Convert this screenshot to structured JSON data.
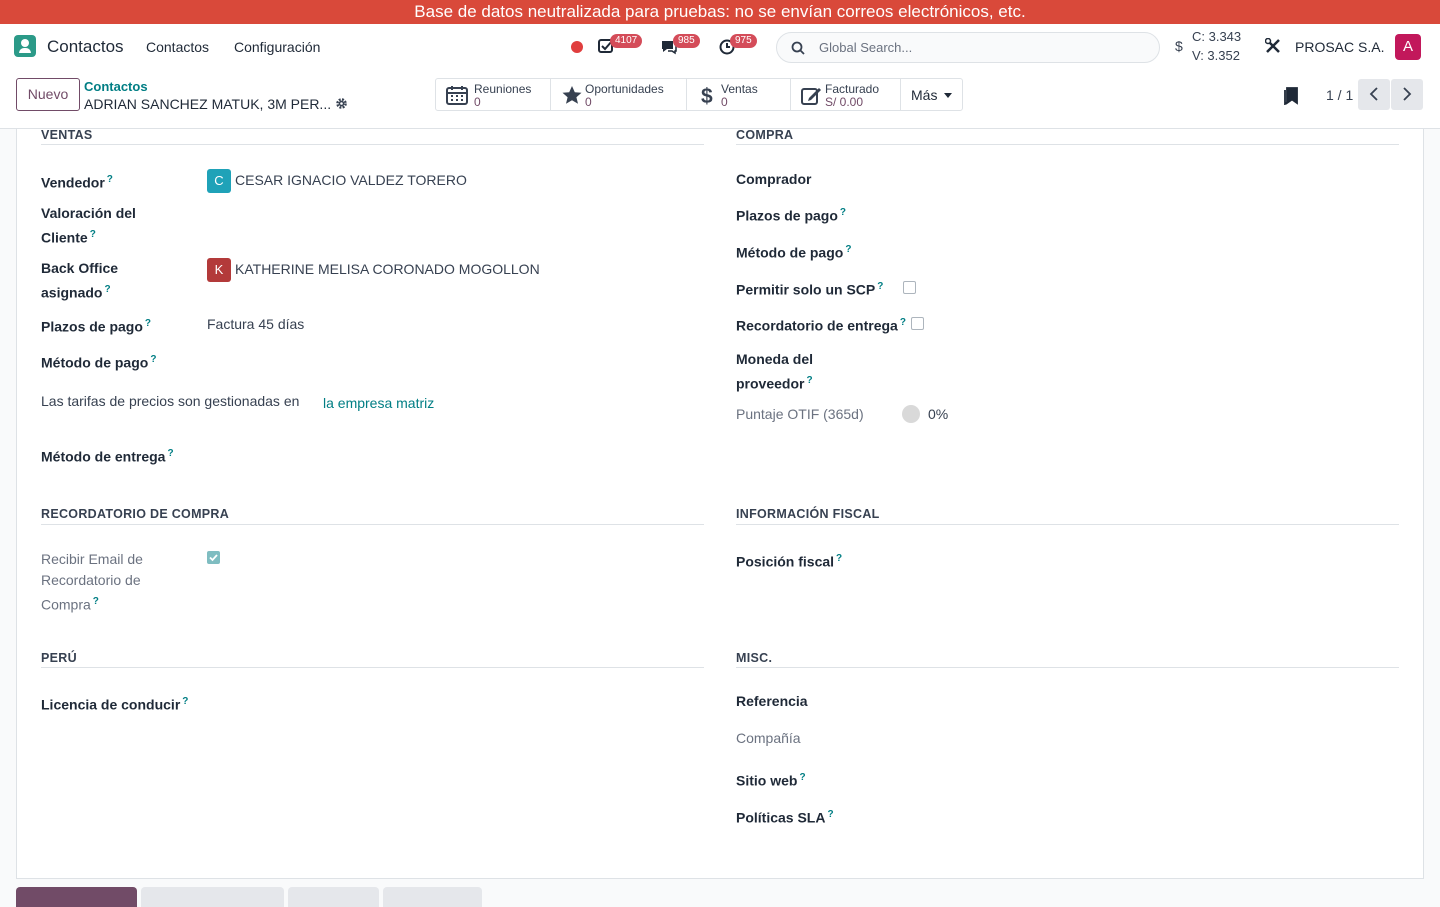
{
  "banner": {
    "text": "Base de datos neutralizada para pruebas: no se envían correos electrónicos, etc."
  },
  "navbar": {
    "app_name": "Contactos",
    "menu": [
      "Contactos",
      "Configuración"
    ],
    "activities_count": "4107",
    "messages_count": "985",
    "timer_count": "975",
    "search_placeholder": "Global Search...",
    "currency_symbol": "$",
    "rate_buy": "C: 3.343",
    "rate_sell": "V: 3.352",
    "company": "PROSAC S.A.",
    "avatar_letter": "A",
    "colors": {
      "brand": "#714b67",
      "banner": "#d9493a",
      "badge": "#d44c59",
      "link": "#017e84"
    }
  },
  "control": {
    "new_button": "Nuevo",
    "breadcrumb": "Contactos",
    "record_name": "ADRIAN SANCHEZ MATUK, 3M PER...",
    "stats": [
      {
        "label": "Reuniones",
        "value": "0",
        "icon": "calendar-icon"
      },
      {
        "label": "Oportunidades",
        "value": "0",
        "icon": "star-icon"
      },
      {
        "label": "Ventas",
        "value": "0",
        "icon": "dollar-icon"
      },
      {
        "label": "Facturado",
        "value": "S/ 0.00",
        "icon": "invoice-edit-icon"
      }
    ],
    "more": "Más",
    "pager": "1 / 1"
  },
  "ventas": {
    "title": "VENTAS",
    "vendedor_label": "Vendedor",
    "vendedor_initial": "C",
    "vendedor_value": "CESAR IGNACIO VALDEZ TORERO",
    "valoracion_label_1": "Valoración del",
    "valoracion_label_2": "Cliente",
    "backoffice_label_1": "Back Office",
    "backoffice_label_2": "asignado",
    "backoffice_initial": "K",
    "backoffice_value": "KATHERINE MELISA CORONADO MOGOLLON",
    "plazos_label": "Plazos de pago",
    "plazos_value": "Factura 45 días",
    "metodo_label": "Método de pago",
    "tarifas_text": "Las tarifas de precios son gestionadas en",
    "tarifas_link": "la empresa matriz",
    "entrega_label": "Método de entrega"
  },
  "compra": {
    "title": "COMPRA",
    "comprador_label": "Comprador",
    "plazos_label": "Plazos de pago",
    "metodo_label": "Método de pago",
    "scp_label": "Permitir solo un SCP",
    "scp_checked": false,
    "recordatorio_label": "Recordatorio de entrega",
    "recordatorio_checked": false,
    "moneda_label_1": "Moneda del",
    "moneda_label_2": "proveedor",
    "otif_label": "Puntaje OTIF (365d)",
    "otif_value": "0%"
  },
  "recordatorio_compra": {
    "title": "RECORDATORIO DE COMPRA",
    "email_label_1": "Recibir Email de",
    "email_label_2": "Recordatorio de",
    "email_label_3": "Compra",
    "email_checked": true
  },
  "fiscal": {
    "title": "INFORMACIÓN FISCAL",
    "posicion_label": "Posición fiscal"
  },
  "peru": {
    "title": "PERÚ",
    "licencia_label": "Licencia de conducir"
  },
  "misc": {
    "title": "MISC.",
    "referencia_label": "Referencia",
    "compania_label": "Compañía",
    "sitio_label": "Sitio web",
    "sla_label": "Políticas SLA"
  },
  "help_mark": "?"
}
